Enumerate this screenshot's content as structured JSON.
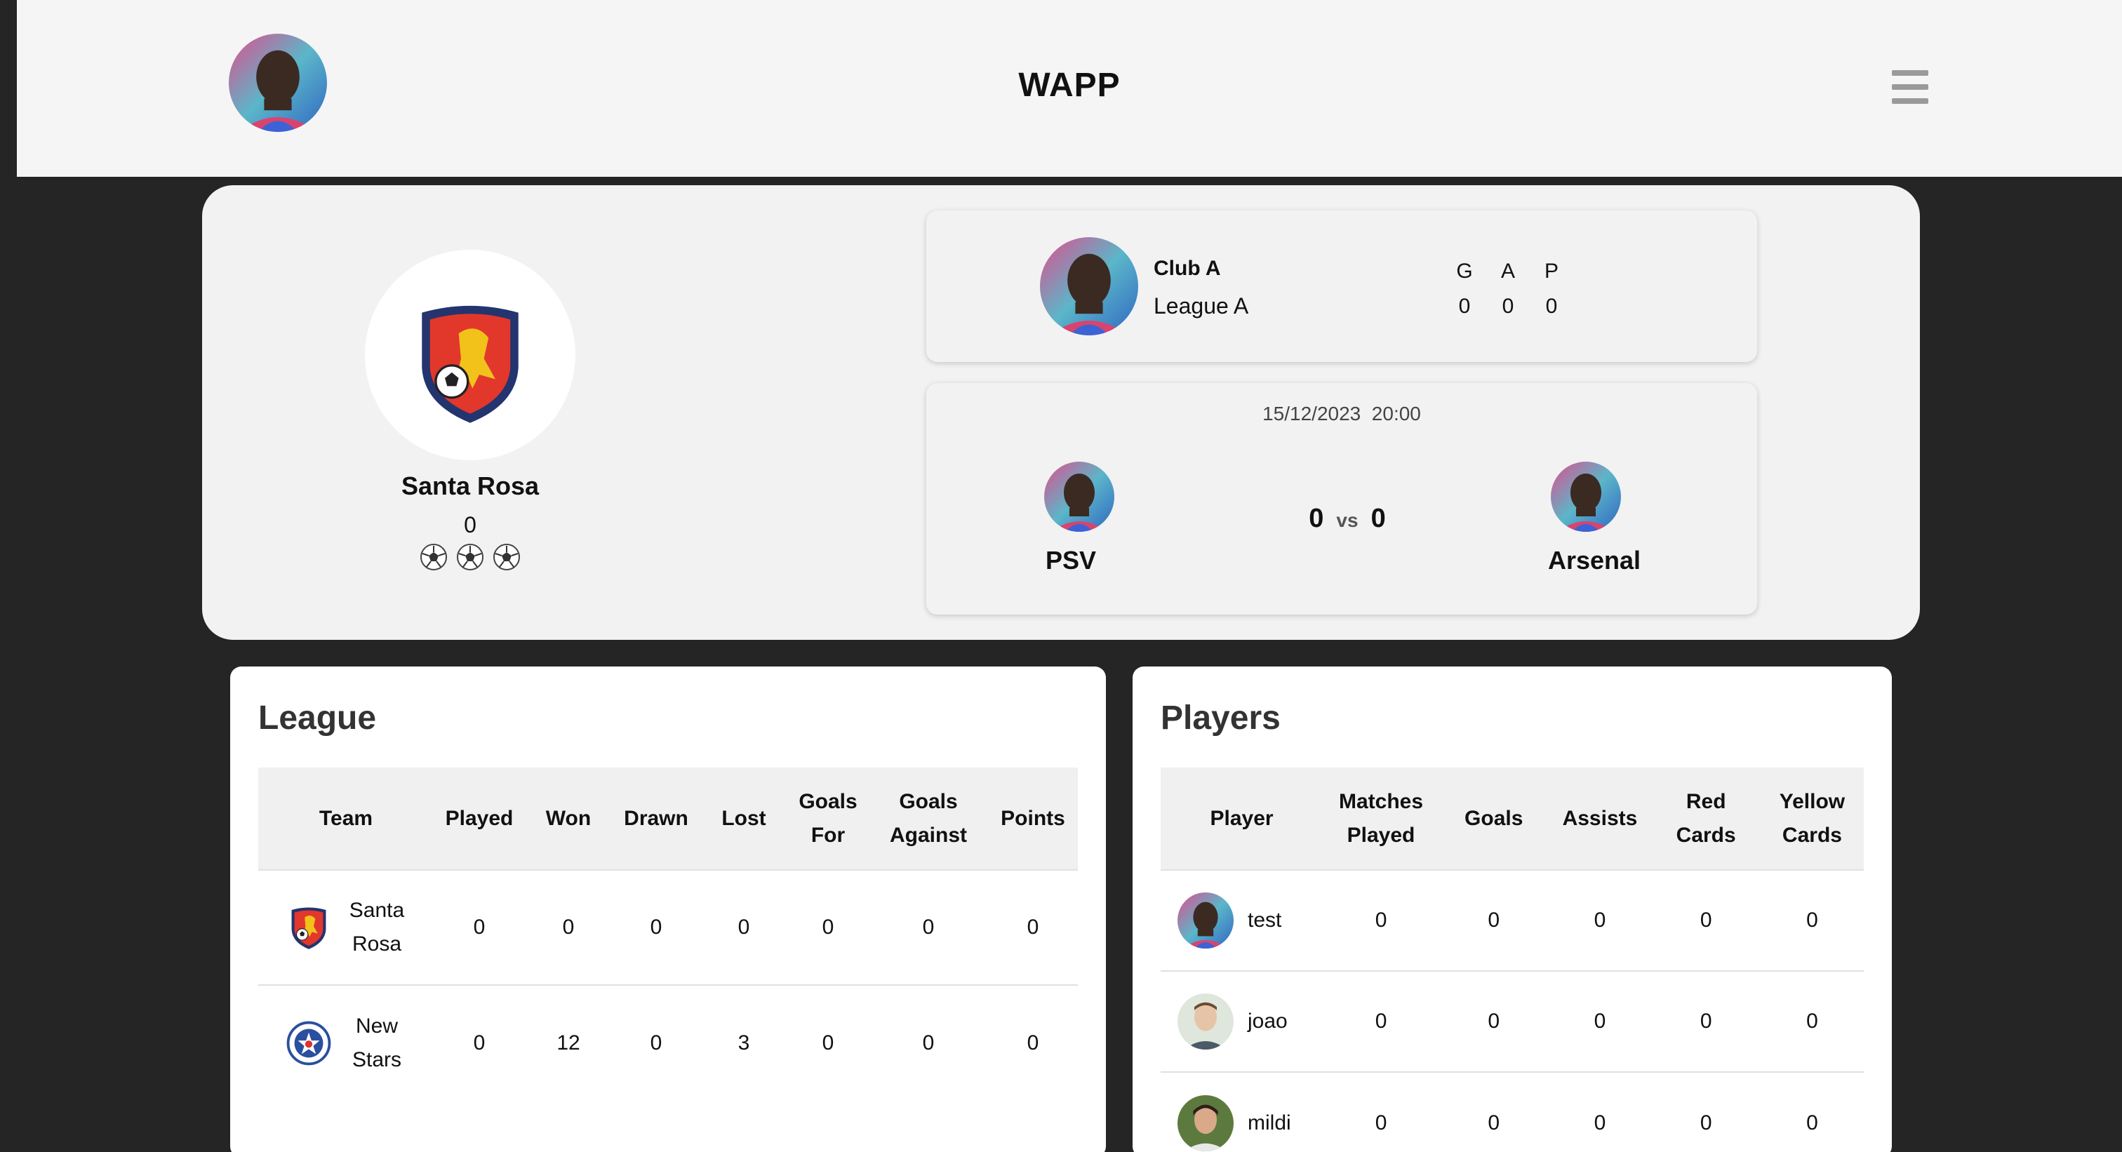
{
  "app": {
    "title": "WAPP"
  },
  "header": {
    "avatar": "user-avatar",
    "menu_icon": "hamburger-menu-icon"
  },
  "profile": {
    "club_name": "Santa Rosa",
    "count": "0",
    "balls": [
      "soccer-ball-icon",
      "soccer-ball-icon",
      "soccer-ball-icon"
    ]
  },
  "club_panel": {
    "name": "Club A",
    "league": "League A",
    "stats": [
      {
        "label": "G",
        "value": "0"
      },
      {
        "label": "A",
        "value": "0"
      },
      {
        "label": "P",
        "value": "0"
      }
    ]
  },
  "fixture": {
    "date": "15/12/2023  20:00",
    "home": "PSV",
    "away": "Arsenal",
    "home_score": "0",
    "away_score": "0",
    "vs": "vs"
  },
  "league": {
    "title": "League",
    "columns": [
      {
        "label": "Team"
      },
      {
        "label": "Played"
      },
      {
        "label": "Won"
      },
      {
        "label": "Drawn"
      },
      {
        "label": "Lost"
      },
      {
        "label": "Goals For"
      },
      {
        "label": "Goals Against"
      },
      {
        "label": "Points"
      }
    ],
    "rows": [
      {
        "team": "Santa Rosa",
        "played": "0",
        "won": "0",
        "drawn": "0",
        "lost": "0",
        "gf": "0",
        "ga": "0",
        "points": "0"
      },
      {
        "team": "New Stars",
        "played": "0",
        "won": "12",
        "drawn": "0",
        "lost": "3",
        "gf": "0",
        "ga": "0",
        "points": "0"
      }
    ]
  },
  "players": {
    "title": "Players",
    "columns": [
      {
        "label": "Player"
      },
      {
        "label": "Matches Played"
      },
      {
        "label": "Goals"
      },
      {
        "label": "Assists"
      },
      {
        "label": "Red Cards"
      },
      {
        "label": "Yellow Cards"
      }
    ],
    "rows": [
      {
        "name": "test",
        "matches": "0",
        "goals": "0",
        "assists": "0",
        "red": "0",
        "yellow": "0"
      },
      {
        "name": "joao",
        "matches": "0",
        "goals": "0",
        "assists": "0",
        "red": "0",
        "yellow": "0"
      },
      {
        "name": "mildi",
        "matches": "0",
        "goals": "0",
        "assists": "0",
        "red": "0",
        "yellow": "0"
      }
    ]
  }
}
